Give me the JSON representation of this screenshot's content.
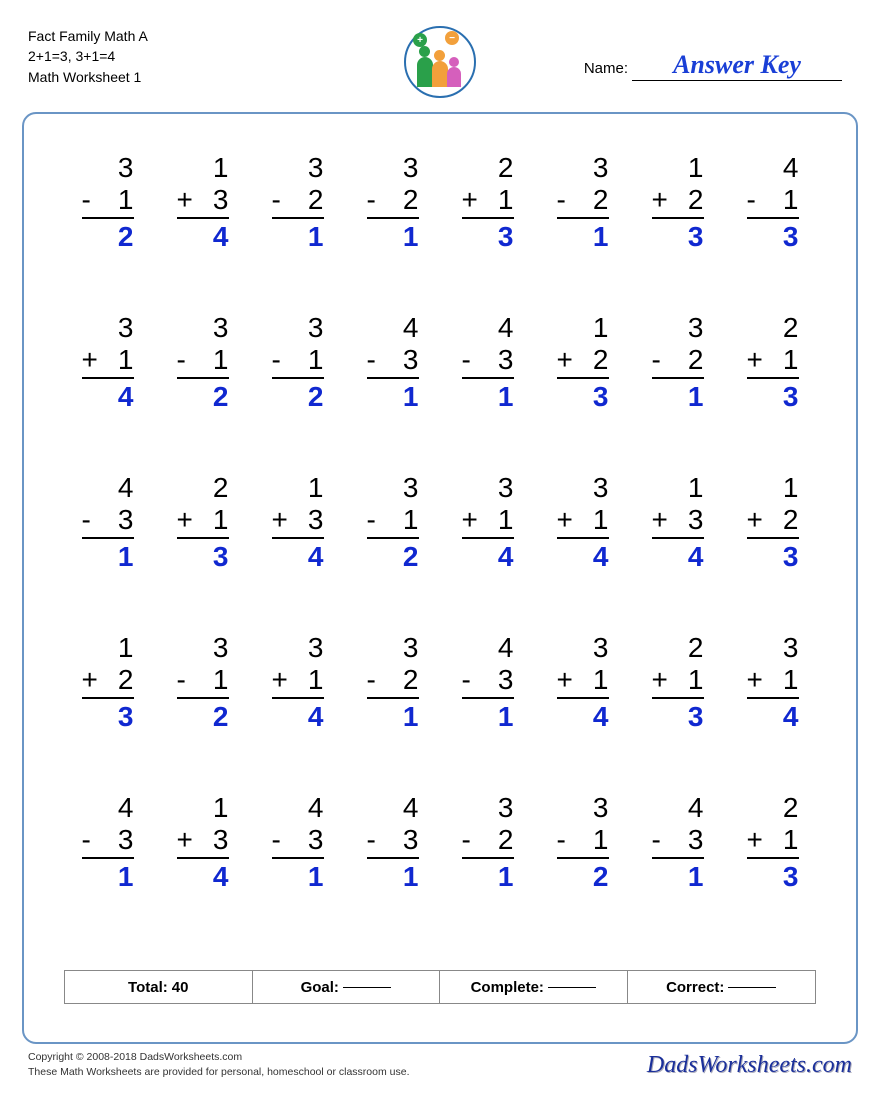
{
  "header": {
    "title_line1": "Fact Family Math A",
    "title_line2": "2+1=3, 3+1=4",
    "title_line3": "Math Worksheet 1",
    "name_label": "Name:",
    "answer_key": "Answer Key"
  },
  "problems": [
    [
      {
        "top": "3",
        "op": "-",
        "num": "1",
        "ans": "2"
      },
      {
        "top": "1",
        "op": "+",
        "num": "3",
        "ans": "4"
      },
      {
        "top": "3",
        "op": "-",
        "num": "2",
        "ans": "1"
      },
      {
        "top": "3",
        "op": "-",
        "num": "2",
        "ans": "1"
      },
      {
        "top": "2",
        "op": "+",
        "num": "1",
        "ans": "3"
      },
      {
        "top": "3",
        "op": "-",
        "num": "2",
        "ans": "1"
      },
      {
        "top": "1",
        "op": "+",
        "num": "2",
        "ans": "3"
      },
      {
        "top": "4",
        "op": "-",
        "num": "1",
        "ans": "3"
      }
    ],
    [
      {
        "top": "3",
        "op": "+",
        "num": "1",
        "ans": "4"
      },
      {
        "top": "3",
        "op": "-",
        "num": "1",
        "ans": "2"
      },
      {
        "top": "3",
        "op": "-",
        "num": "1",
        "ans": "2"
      },
      {
        "top": "4",
        "op": "-",
        "num": "3",
        "ans": "1"
      },
      {
        "top": "4",
        "op": "-",
        "num": "3",
        "ans": "1"
      },
      {
        "top": "1",
        "op": "+",
        "num": "2",
        "ans": "3"
      },
      {
        "top": "3",
        "op": "-",
        "num": "2",
        "ans": "1"
      },
      {
        "top": "2",
        "op": "+",
        "num": "1",
        "ans": "3"
      }
    ],
    [
      {
        "top": "4",
        "op": "-",
        "num": "3",
        "ans": "1"
      },
      {
        "top": "2",
        "op": "+",
        "num": "1",
        "ans": "3"
      },
      {
        "top": "1",
        "op": "+",
        "num": "3",
        "ans": "4"
      },
      {
        "top": "3",
        "op": "-",
        "num": "1",
        "ans": "2"
      },
      {
        "top": "3",
        "op": "+",
        "num": "1",
        "ans": "4"
      },
      {
        "top": "3",
        "op": "+",
        "num": "1",
        "ans": "4"
      },
      {
        "top": "1",
        "op": "+",
        "num": "3",
        "ans": "4"
      },
      {
        "top": "1",
        "op": "+",
        "num": "2",
        "ans": "3"
      }
    ],
    [
      {
        "top": "1",
        "op": "+",
        "num": "2",
        "ans": "3"
      },
      {
        "top": "3",
        "op": "-",
        "num": "1",
        "ans": "2"
      },
      {
        "top": "3",
        "op": "+",
        "num": "1",
        "ans": "4"
      },
      {
        "top": "3",
        "op": "-",
        "num": "2",
        "ans": "1"
      },
      {
        "top": "4",
        "op": "-",
        "num": "3",
        "ans": "1"
      },
      {
        "top": "3",
        "op": "+",
        "num": "1",
        "ans": "4"
      },
      {
        "top": "2",
        "op": "+",
        "num": "1",
        "ans": "3"
      },
      {
        "top": "3",
        "op": "+",
        "num": "1",
        "ans": "4"
      }
    ],
    [
      {
        "top": "4",
        "op": "-",
        "num": "3",
        "ans": "1"
      },
      {
        "top": "1",
        "op": "+",
        "num": "3",
        "ans": "4"
      },
      {
        "top": "4",
        "op": "-",
        "num": "3",
        "ans": "1"
      },
      {
        "top": "4",
        "op": "-",
        "num": "3",
        "ans": "1"
      },
      {
        "top": "3",
        "op": "-",
        "num": "2",
        "ans": "1"
      },
      {
        "top": "3",
        "op": "-",
        "num": "1",
        "ans": "2"
      },
      {
        "top": "4",
        "op": "-",
        "num": "3",
        "ans": "1"
      },
      {
        "top": "2",
        "op": "+",
        "num": "1",
        "ans": "3"
      }
    ]
  ],
  "stats": {
    "total_label": "Total:",
    "total_value": "40",
    "goal_label": "Goal:",
    "complete_label": "Complete:",
    "correct_label": "Correct:"
  },
  "footer": {
    "copyright": "Copyright © 2008-2018 DadsWorksheets.com",
    "disclaimer": "These Math Worksheets are provided for personal, homeschool or classroom use.",
    "brand": "DadsWorksheets.com"
  }
}
